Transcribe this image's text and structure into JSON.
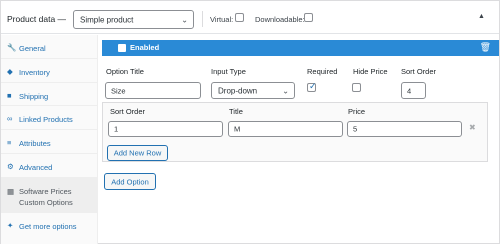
{
  "header": {
    "title": "Product data —",
    "product_type": "Simple product",
    "virtual_label": "Virtual:",
    "downloadable_label": "Downloadable:"
  },
  "sidebar": {
    "items": [
      {
        "icon": "wrench-icon",
        "glyph": "🔧",
        "label": "General"
      },
      {
        "icon": "tag-icon",
        "glyph": "◆",
        "label": "Inventory"
      },
      {
        "icon": "truck-icon",
        "glyph": "■",
        "label": "Shipping"
      },
      {
        "icon": "link-icon",
        "glyph": "∞",
        "label": "Linked Products"
      },
      {
        "icon": "list-icon",
        "glyph": "≡",
        "label": "Attributes"
      },
      {
        "icon": "gear-icon",
        "glyph": "⚙",
        "label": "Advanced"
      },
      {
        "icon": "grid-icon",
        "glyph": "▦",
        "label": "Software Prices Custom Options"
      },
      {
        "icon": "plugin-icon",
        "glyph": "✦",
        "label": "Get more options"
      }
    ]
  },
  "option": {
    "enabled_label": "Enabled",
    "headers": {
      "option_title": "Option Title",
      "input_type": "Input Type",
      "required": "Required",
      "hide_price": "Hide Price",
      "sort_order": "Sort Order"
    },
    "values": {
      "option_title": "Size",
      "input_type": "Drop-down",
      "required": true,
      "hide_price": false,
      "sort_order": "4"
    }
  },
  "rows": {
    "headers": {
      "sort_order": "Sort Order",
      "title": "Title",
      "price": "Price"
    },
    "items": [
      {
        "sort_order": "1",
        "title": "M",
        "price": "5"
      }
    ],
    "add_row_label": "Add New Row"
  },
  "add_option_label": "Add Option",
  "colors": {
    "accent": "#2271b1",
    "bar": "#2a8ad6"
  }
}
